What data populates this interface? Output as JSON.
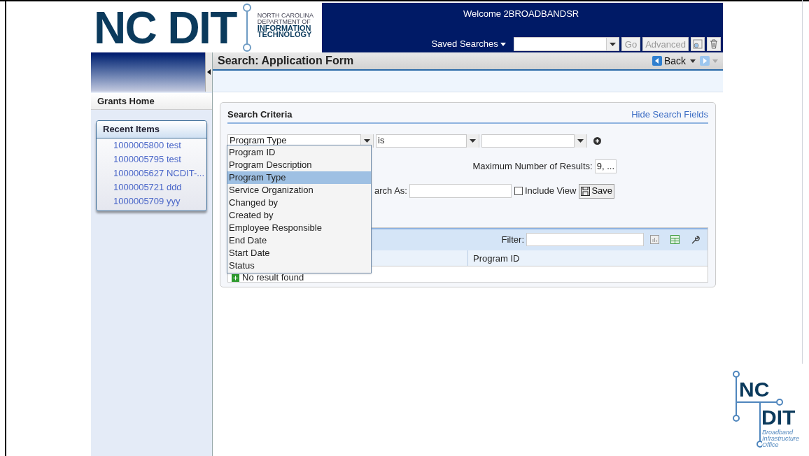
{
  "header": {
    "logo_wordmark": "NC DIT",
    "logo_lines": [
      "NORTH CAROLINA",
      "DEPARTMENT OF",
      "INFORMATION",
      "TECHNOLOGY"
    ],
    "welcome": "Welcome 2BROADBANDSR",
    "saved_searches_label": "Saved Searches",
    "go_button": "Go",
    "advanced_button": "Advanced"
  },
  "sidebar": {
    "tab": "Grants Home",
    "recent_items": {
      "title": "Recent Items",
      "items": [
        "1000005800 test",
        "1000005795 test",
        "1000005627 NCDIT-...",
        "1000005721 ddd",
        "1000005709 yyy"
      ]
    }
  },
  "page": {
    "title": "Search: Application Form",
    "back_button": "Back"
  },
  "search_criteria": {
    "title": "Search Criteria",
    "hide_link": "Hide Search Fields",
    "field_select": "Program Type",
    "operator_select": "is",
    "max_results_label": "Maximum Number of Results:",
    "max_results_value": "9, ...",
    "save_as_label": "arch As:",
    "include_view": {
      "label": "Include View",
      "checked": false
    },
    "save_button": "Save"
  },
  "field_dropdown": {
    "options": [
      {
        "label": "Program ID",
        "selected": false
      },
      {
        "label": "Program Description",
        "selected": false
      },
      {
        "label": "Program Type",
        "selected": true
      },
      {
        "label": "Service Organization",
        "selected": false
      },
      {
        "label": "Changed by",
        "selected": false
      },
      {
        "label": "Created by",
        "selected": false
      },
      {
        "label": "Employee Responsible",
        "selected": false
      },
      {
        "label": "End Date",
        "selected": false
      },
      {
        "label": "Start Date",
        "selected": false
      },
      {
        "label": "Status",
        "selected": false
      }
    ]
  },
  "results": {
    "filter_label": "Filter:",
    "columns": [
      "Program ID"
    ],
    "empty_message": "No result found"
  },
  "footer_logo": {
    "lines": [
      "NC",
      "DIT"
    ],
    "subtitle": [
      "Broadband",
      "Infrastructure",
      "Office"
    ]
  }
}
